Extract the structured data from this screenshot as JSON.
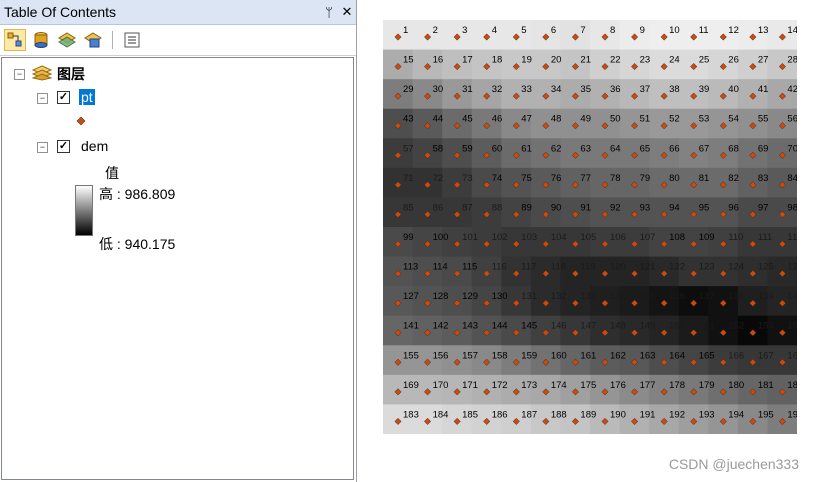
{
  "toc": {
    "title": "Table Of Contents",
    "pin_glyph": "ᛘ",
    "close_glyph": "✕",
    "toolbar": [
      {
        "name": "list-by-drawing-order-icon",
        "active": true
      },
      {
        "name": "list-by-source-icon",
        "active": false
      },
      {
        "name": "list-by-visibility-icon",
        "active": false
      },
      {
        "name": "list-by-selection-icon",
        "active": false
      },
      {
        "name": "options-icon",
        "active": false
      }
    ],
    "root": {
      "label": "图层",
      "expander": "⊟"
    },
    "layers": [
      {
        "label": "pt",
        "expander": "⊟",
        "checked": "✓",
        "selected": true,
        "symbol_color": "#c0501a"
      },
      {
        "label": "dem",
        "expander": "⊟",
        "checked": "✓",
        "selected": false,
        "legend_title": "值",
        "high": "高 : 986.809",
        "low": "低 : 940.175"
      }
    ]
  },
  "map": {
    "point_color": "#c44d16",
    "label_color": "#000000",
    "point_count": 196,
    "columns": 14,
    "rows": 14,
    "point_ids_start": 1,
    "darkness_grid": [
      [
        0.05,
        0.05,
        0.05,
        0.05,
        0.05,
        0.06,
        0.07,
        0.05,
        0.03,
        0.02,
        0.02,
        0.02,
        0.03,
        0.04
      ],
      [
        0.3,
        0.25,
        0.22,
        0.2,
        0.18,
        0.18,
        0.2,
        0.15,
        0.12,
        0.1,
        0.1,
        0.12,
        0.15,
        0.18
      ],
      [
        0.5,
        0.45,
        0.38,
        0.33,
        0.28,
        0.28,
        0.3,
        0.28,
        0.25,
        0.22,
        0.22,
        0.24,
        0.28,
        0.32
      ],
      [
        0.7,
        0.65,
        0.58,
        0.52,
        0.45,
        0.42,
        0.42,
        0.42,
        0.4,
        0.38,
        0.38,
        0.4,
        0.42,
        0.45
      ],
      [
        0.78,
        0.75,
        0.7,
        0.64,
        0.58,
        0.55,
        0.52,
        0.52,
        0.52,
        0.5,
        0.48,
        0.5,
        0.55,
        0.58
      ],
      [
        0.82,
        0.82,
        0.78,
        0.72,
        0.68,
        0.65,
        0.62,
        0.6,
        0.6,
        0.58,
        0.58,
        0.58,
        0.62,
        0.65
      ],
      [
        0.8,
        0.8,
        0.8,
        0.78,
        0.75,
        0.72,
        0.7,
        0.68,
        0.68,
        0.68,
        0.68,
        0.68,
        0.72,
        0.72
      ],
      [
        0.72,
        0.74,
        0.76,
        0.78,
        0.8,
        0.8,
        0.8,
        0.78,
        0.78,
        0.75,
        0.75,
        0.76,
        0.8,
        0.8
      ],
      [
        0.68,
        0.7,
        0.72,
        0.76,
        0.82,
        0.85,
        0.88,
        0.88,
        0.88,
        0.86,
        0.82,
        0.82,
        0.84,
        0.86
      ],
      [
        0.66,
        0.68,
        0.7,
        0.74,
        0.8,
        0.85,
        0.88,
        0.9,
        0.92,
        0.95,
        0.98,
        0.96,
        0.9,
        0.88
      ],
      [
        0.6,
        0.62,
        0.64,
        0.68,
        0.72,
        0.76,
        0.8,
        0.84,
        0.86,
        0.88,
        0.92,
        0.96,
        1.0,
        0.96
      ],
      [
        0.4,
        0.4,
        0.42,
        0.45,
        0.5,
        0.55,
        0.6,
        0.64,
        0.66,
        0.7,
        0.74,
        0.78,
        0.8,
        0.8
      ],
      [
        0.25,
        0.25,
        0.26,
        0.28,
        0.3,
        0.32,
        0.35,
        0.4,
        0.44,
        0.48,
        0.52,
        0.56,
        0.6,
        0.62
      ],
      [
        0.1,
        0.1,
        0.12,
        0.14,
        0.15,
        0.18,
        0.2,
        0.24,
        0.28,
        0.32,
        0.36,
        0.4,
        0.45,
        0.5
      ]
    ]
  },
  "watermark": "CSDN @juechen333"
}
